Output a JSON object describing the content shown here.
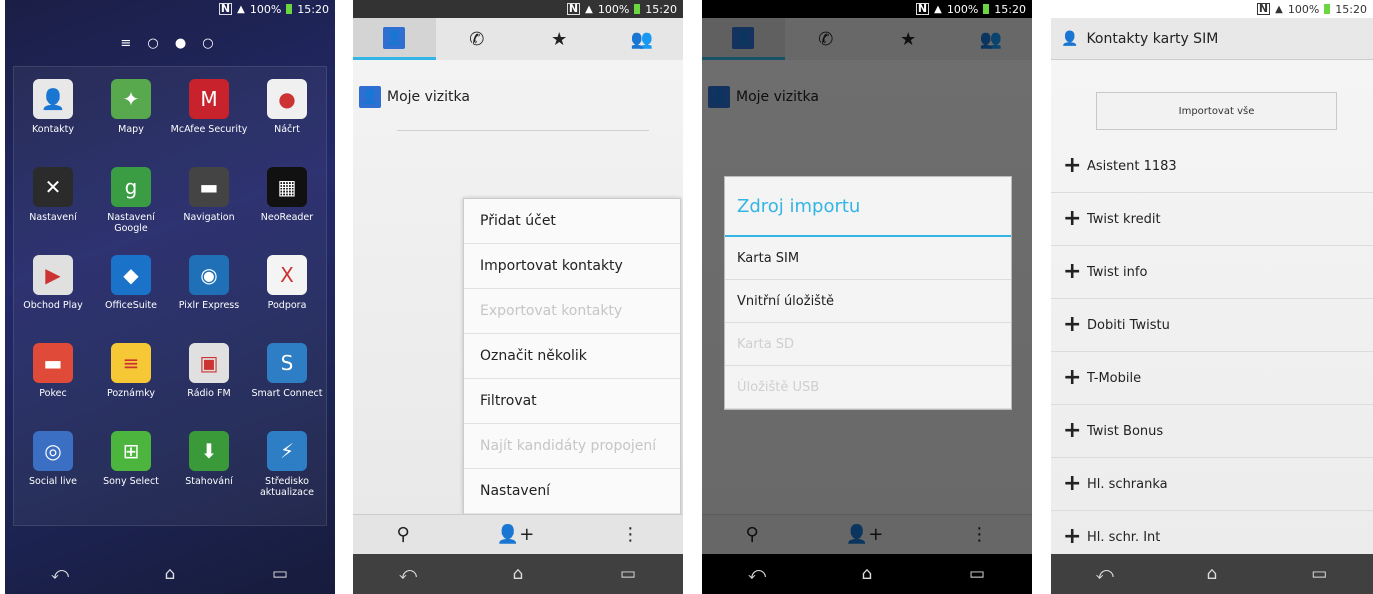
{
  "status": {
    "nfc": "N",
    "signal": "▲",
    "battery_pct": "100%",
    "time": "15:20"
  },
  "home": {
    "page_dots": "≡ ○ ● ○",
    "apps": [
      {
        "label": "Kontakty",
        "icon": "contacts-icon",
        "glyph": "👤",
        "color": "#e8e8e8"
      },
      {
        "label": "Mapy",
        "icon": "maps-icon",
        "glyph": "✦",
        "color": "#58a84e"
      },
      {
        "label": "McAfee Security",
        "icon": "mcafee-icon",
        "glyph": "M",
        "color": "#c8232c"
      },
      {
        "label": "Náčrt",
        "icon": "sketch-icon",
        "glyph": "●",
        "color": "#f0f0f0"
      },
      {
        "label": "Nastavení",
        "icon": "settings-icon",
        "glyph": "✕",
        "color": "#2b2b2b"
      },
      {
        "label": "Nastavení Google",
        "icon": "google-settings-icon",
        "glyph": "g",
        "color": "#3b9d43"
      },
      {
        "label": "Navigation",
        "icon": "navigation-icon",
        "glyph": "▬",
        "color": "#444"
      },
      {
        "label": "NeoReader",
        "icon": "neoreader-icon",
        "glyph": "▦",
        "color": "#111"
      },
      {
        "label": "Obchod Play",
        "icon": "play-store-icon",
        "glyph": "▶",
        "color": "#e0e0e0"
      },
      {
        "label": "OfficeSuite",
        "icon": "officesuite-icon",
        "glyph": "◆",
        "color": "#1a73c9"
      },
      {
        "label": "Pixlr Express",
        "icon": "pixlr-icon",
        "glyph": "◉",
        "color": "#2070b8"
      },
      {
        "label": "Podpora",
        "icon": "support-icon",
        "glyph": "X",
        "color": "#f4f4f4"
      },
      {
        "label": "Pokec",
        "icon": "pokec-icon",
        "glyph": "▬",
        "color": "#e04a38"
      },
      {
        "label": "Poznámky",
        "icon": "notes-icon",
        "glyph": "≡",
        "color": "#f7c836"
      },
      {
        "label": "Rádio FM",
        "icon": "radio-icon",
        "glyph": "▣",
        "color": "#e0e0e0"
      },
      {
        "label": "Smart Connect",
        "icon": "smart-connect-icon",
        "glyph": "S",
        "color": "#2d7ec4"
      },
      {
        "label": "Social live",
        "icon": "social-live-icon",
        "glyph": "◎",
        "color": "#3a6fc4"
      },
      {
        "label": "Sony Select",
        "icon": "sony-select-icon",
        "glyph": "⊞",
        "color": "#4cb53d"
      },
      {
        "label": "Stahování",
        "icon": "download-icon",
        "glyph": "⬇",
        "color": "#3a9a3a"
      },
      {
        "label": "Středisko aktualizace",
        "icon": "update-center-icon",
        "glyph": "⚡",
        "color": "#2d7ec4"
      }
    ]
  },
  "contacts": {
    "tabs": [
      {
        "icon": "contacts-tab-icon",
        "glyph": "👤"
      },
      {
        "icon": "phone-tab-icon",
        "glyph": "✆"
      },
      {
        "icon": "favorites-tab-icon",
        "glyph": "★"
      },
      {
        "icon": "groups-tab-icon",
        "glyph": "👥"
      }
    ],
    "my_card": "Moje vizitka",
    "menu": [
      {
        "label": "Přidat účet",
        "enabled": true
      },
      {
        "label": "Importovat kontakty",
        "enabled": true
      },
      {
        "label": "Exportovat kontakty",
        "enabled": false
      },
      {
        "label": "Označit několik",
        "enabled": true
      },
      {
        "label": "Filtrovat",
        "enabled": true
      },
      {
        "label": "Najít kandidáty propojení",
        "enabled": false
      },
      {
        "label": "Nastavení",
        "enabled": true
      }
    ],
    "bottom": {
      "search": "⚲",
      "add": "👤+",
      "more": "⋮"
    }
  },
  "import_dialog": {
    "title": "Zdroj importu",
    "items": [
      {
        "label": "Karta SIM",
        "enabled": true
      },
      {
        "label": "Vnitřní úložiště",
        "enabled": true
      },
      {
        "label": "Karta SD",
        "enabled": false
      },
      {
        "label": "Úložiště USB",
        "enabled": false
      }
    ]
  },
  "sim": {
    "title": "Kontakty karty SIM",
    "import_all": "Importovat vše",
    "contacts": [
      "Asistent 1183",
      "Twist kredit",
      "Twist info",
      "Dobiti Twistu",
      "T-Mobile",
      "Twist Bonus",
      "Hl. schranka",
      "Hl. schr. Int"
    ]
  },
  "nav": {
    "back": "⤺",
    "home": "⌂",
    "recent": "▭"
  }
}
